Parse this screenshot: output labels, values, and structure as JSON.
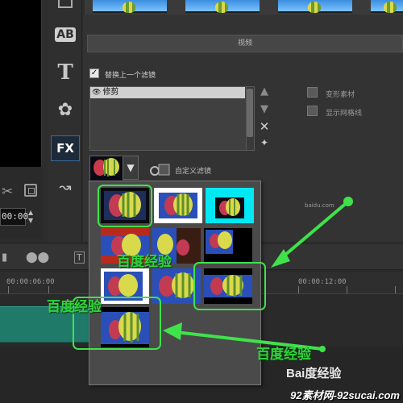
{
  "panel": {
    "section_title": "视频",
    "replace_prev_filter_label": "替换上一个滤镜",
    "replace_prev_filter_checked": true,
    "filters": [
      {
        "label": "修剪"
      }
    ],
    "options": {
      "transform_label": "变形素材",
      "grid_label": "显示网格线"
    },
    "custom_filter_label": "自定义滤镜"
  },
  "left": {
    "timecode": "00:00"
  },
  "timeline": {
    "ruler_labels": [
      "00:00:06:00",
      "00:00:12:00"
    ]
  },
  "annotations": {
    "text_1": "百度经验",
    "text_2": "百度经验",
    "text_3": "百度经验",
    "color": "#3fe24a"
  },
  "watermarks": {
    "baidu_logo": "Bai度经验",
    "baidu_sub": "baidu.com",
    "footer": "92素材网-92sucai.com"
  },
  "icons": [
    "title-ab-icon",
    "text-t-icon",
    "graphics-flower-icon",
    "fx-icon",
    "path-icon",
    "scissors-icon",
    "copy-icon",
    "close-icon",
    "add-star-icon"
  ]
}
